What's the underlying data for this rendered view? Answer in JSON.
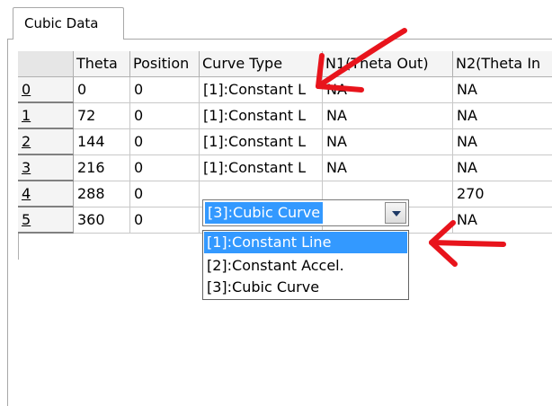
{
  "tab": {
    "label": "Cubic Data"
  },
  "grid": {
    "columns": [
      "",
      "Theta",
      "Position",
      "Curve Type",
      "N1(Theta Out)",
      "N2(Theta In"
    ],
    "rows": [
      {
        "index": "0",
        "theta": "0",
        "position": "0",
        "curve": "[1]:Constant L",
        "n1": "NA",
        "n2": "NA"
      },
      {
        "index": "1",
        "theta": "72",
        "position": "0",
        "curve": "[1]:Constant L",
        "n1": "NA",
        "n2": "NA"
      },
      {
        "index": "2",
        "theta": "144",
        "position": "0",
        "curve": "[1]:Constant L",
        "n1": "NA",
        "n2": "NA"
      },
      {
        "index": "3",
        "theta": "216",
        "position": "0",
        "curve": "[1]:Constant L",
        "n1": "NA",
        "n2": "NA"
      },
      {
        "index": "4",
        "theta": "288",
        "position": "0",
        "curve": "",
        "n1": "",
        "n2": "270"
      },
      {
        "index": "5",
        "theta": "360",
        "position": "0",
        "curve": "",
        "n1": "",
        "n2": "NA"
      }
    ]
  },
  "combo": {
    "selected_value": "[3]:Cubic Curve",
    "options": [
      "[1]:Constant Line",
      "[2]:Constant Accel.",
      "[3]:Cubic Curve"
    ],
    "highlighted_option": "[1]:Constant Line"
  },
  "annotations": {
    "arrow_color": "#e8141c"
  },
  "colors": {
    "selection": "#3399ff",
    "header_bg": "#f4f4f4"
  }
}
